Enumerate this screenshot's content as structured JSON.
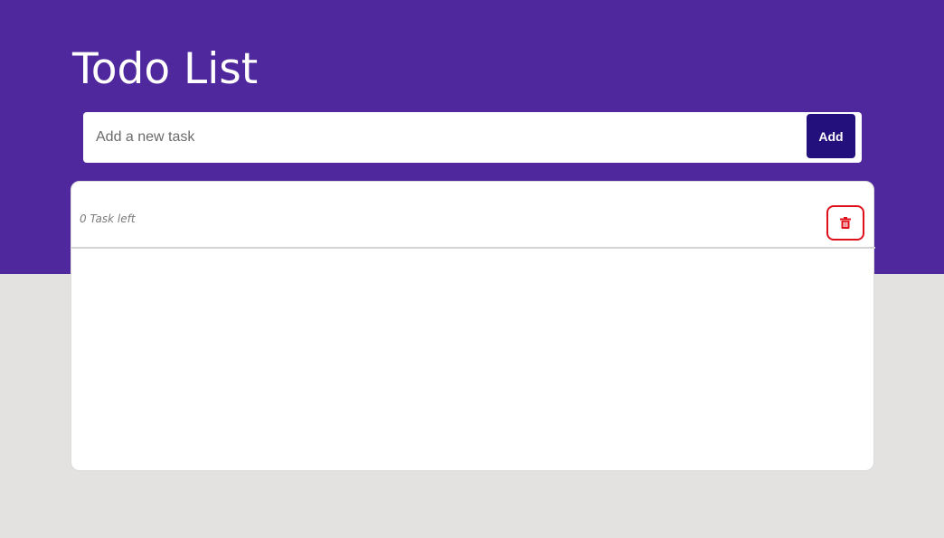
{
  "header": {
    "title": "Todo List"
  },
  "add_task": {
    "placeholder": "Add a new task",
    "value": "",
    "button_label": "Add"
  },
  "list": {
    "tasks_left_text": "0 Task left",
    "clear_icon": "trash-icon",
    "items": []
  },
  "colors": {
    "header_bg": "#4f289e",
    "page_bg": "#e4e1e1",
    "add_button_bg": "#24107c",
    "clear_accent": "#e0101a"
  }
}
